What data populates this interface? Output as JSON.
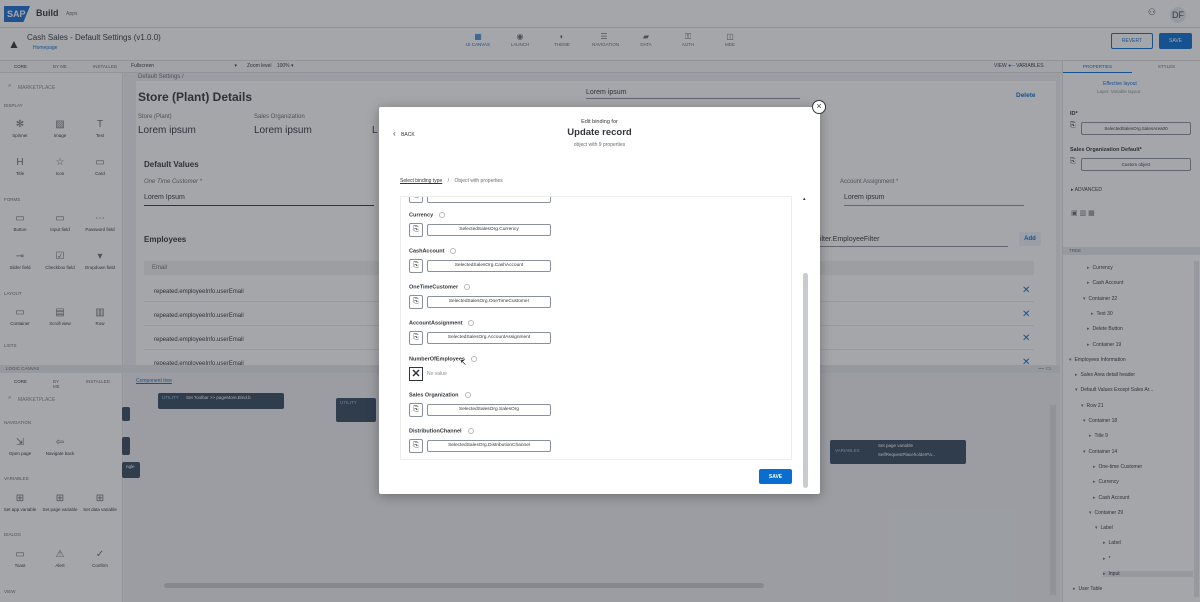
{
  "header": {
    "logo": "SAP",
    "brand": "Build",
    "brand_sub": "Apps",
    "avatar": "DF"
  },
  "app": {
    "title": "Cash Sales - Default Settings (v1.0.0)",
    "homepage_link": "Homepage",
    "nav": [
      {
        "label": "UI CANVAS",
        "icon": "▦"
      },
      {
        "label": "LAUNCH",
        "icon": "◉"
      },
      {
        "label": "THEME",
        "icon": "◐"
      },
      {
        "label": "NAVIGATION",
        "icon": "☰"
      },
      {
        "label": "DATA",
        "icon": "▰"
      },
      {
        "label": "AUTH",
        "icon": "⚿"
      },
      {
        "label": "MDE",
        "icon": "◫"
      }
    ],
    "revert_label": "REVERT",
    "save_label": "SAVE"
  },
  "toolbar": {
    "panel_tabs": [
      "CORE",
      "BY ME",
      "INSTALLED"
    ],
    "view_select": "Fullscreen",
    "zoom_label": "Zoom level",
    "zoom_value": "100%",
    "view_label": "VIEW",
    "variables_label": "VARIABLES"
  },
  "left_panel": {
    "search": "MARKETPLACE",
    "sections": {
      "display": "DISPLAY",
      "forms": "FORMS",
      "layout": "LAYOUT",
      "lists": "LISTS"
    },
    "display": [
      {
        "label": "Spinner",
        "icon": "✻"
      },
      {
        "label": "Image",
        "icon": "▨"
      },
      {
        "label": "Text",
        "icon": "T"
      },
      {
        "label": "Title",
        "icon": "H"
      },
      {
        "label": "Icon",
        "icon": "☆"
      },
      {
        "label": "Card",
        "icon": "▭"
      }
    ],
    "forms": [
      {
        "label": "Button",
        "icon": "▭"
      },
      {
        "label": "Input field",
        "icon": "▭"
      },
      {
        "label": "Password field",
        "icon": "⋯"
      },
      {
        "label": "Slider field",
        "icon": "⊸"
      },
      {
        "label": "Checkbox field",
        "icon": "☑"
      },
      {
        "label": "Dropdown field",
        "icon": "▾"
      }
    ],
    "layout": [
      {
        "label": "Container",
        "icon": "▭"
      },
      {
        "label": "Scroll view",
        "icon": "▤"
      },
      {
        "label": "Row",
        "icon": "▥"
      }
    ]
  },
  "canvas": {
    "breadcrumb": "Default Settings /",
    "title": "Store (Plant) Details",
    "delete_label": "Delete",
    "store_plant_label": "Store (Plant)",
    "store_plant_value": "Lorem ipsum",
    "sales_org_label": "Sales Organization",
    "sales_org_value": "Lorem ipsum",
    "col3_value": "L",
    "right_value": "Lorem ipsum",
    "default_values_title": "Default Values",
    "one_time_customer_label": "One Time Customer *",
    "one_time_customer_value": "Lorem Ipsum",
    "account_assignment_label": "Account Assignment *",
    "account_assignment_value": "Lorem ipsum",
    "employees_title": "Employees",
    "employee_filter": "filter.EmployeeFilter",
    "add_label": "Add",
    "email_header": "Email",
    "rows": [
      "repeated.employeeInfo.userEmail",
      "repeated.employeeInfo.userEmail",
      "repeated.employeeInfo.userEmail",
      "repeated.employeeInfo.userEmail"
    ]
  },
  "logic": {
    "bar_label": "LOGIC CANVAS",
    "tabs": [
      "CORE",
      "BY ME",
      "INSTALLED"
    ],
    "component_tab": "Component tree",
    "search": "MARKETPLACE",
    "sections": {
      "navigation": "NAVIGATION",
      "variables": "VARIABLES",
      "dialog": "DIALOG",
      "view": "VIEW"
    },
    "navigation": [
      {
        "label": "Open page",
        "icon": "⇲"
      },
      {
        "label": "Navigate back",
        "icon": "⇦"
      }
    ],
    "variables": [
      {
        "label": "Set app variable",
        "icon": "⊞"
      },
      {
        "label": "Set page variable",
        "icon": "⊞"
      },
      {
        "label": "Set data variable",
        "icon": "⊞"
      }
    ],
    "dialog": [
      {
        "label": "Toast",
        "icon": "▭"
      },
      {
        "label": "Alert",
        "icon": "⚠"
      },
      {
        "label": "Confirm",
        "icon": "✓"
      }
    ],
    "node1_type": "UTILITY",
    "node1_text": "Set Toolbar >> pageMore.Bind.b",
    "node2_type": "UTILITY",
    "node3_type": "VARIABLES",
    "node3_text": "Set page variable",
    "node3_sub": "SelfRequestPlaceholderPa...",
    "node_left_text": "ngle"
  },
  "right_panel": {
    "tabs": [
      "PROPERTIES",
      "STYLES"
    ],
    "top_text": "Effective layout",
    "top_sub": "Layer: Variable layout",
    "id_label": "ID*",
    "id_value": "SelectedSalesOrg.SalesArea00",
    "sales_org_default_label": "Sales Organization Default*",
    "sales_org_default_value": "Custom object",
    "advanced_label": "ADVANCED",
    "tree_label": "TREE",
    "tree": [
      "Currency",
      "Cash Account",
      "Container 22",
      "Text 30",
      "Delete Button",
      "Container 19",
      "Employees Information",
      "Sales Area detail header",
      "Default Values Except Sales Ar...",
      "Row 21",
      "Container 18",
      "Title 9",
      "Container 14",
      "One-time Customer",
      "Currency",
      "Cash Account",
      "Container 29",
      "Label",
      "Label",
      "*",
      "Input",
      "User Table"
    ]
  },
  "dialog": {
    "back_label": "BACK",
    "kicker": "Edit binding for",
    "title": "Update record",
    "subtitle": "object with 9 properties",
    "breadcrumb_link": "Select binding type",
    "breadcrumb_sep": "/",
    "breadcrumb_current": "Object with properties",
    "close_icon": "×",
    "bind_icon": "⎘",
    "no_value_icon": "✕",
    "properties": [
      {
        "name": "Currency",
        "value": "SelectedSalesOrg.Currency"
      },
      {
        "name": "CashAccount",
        "value": "SelectedSalesOrg.CashAccount"
      },
      {
        "name": "OneTimeCustomer",
        "value": "SelectedSalesOrg.OneTimeCustomer"
      },
      {
        "name": "AccountAssignment",
        "value": "SelectedSalesOrg.AccountAssignment"
      },
      {
        "name": "NumberOfEmployees",
        "value": ""
      },
      {
        "name": "Sales Organization",
        "value": "SelectedSalesOrg.SalesOrg"
      },
      {
        "name": "DistributionChannel",
        "value": "SelectedSalesOrg.DistributionChannel"
      }
    ],
    "no_value_text": "No value",
    "save_label": "SAVE"
  },
  "colors": {
    "accent": "#0a6ed1",
    "node": "#354a5f",
    "overlay": "rgba(40,44,52,0.42)"
  }
}
